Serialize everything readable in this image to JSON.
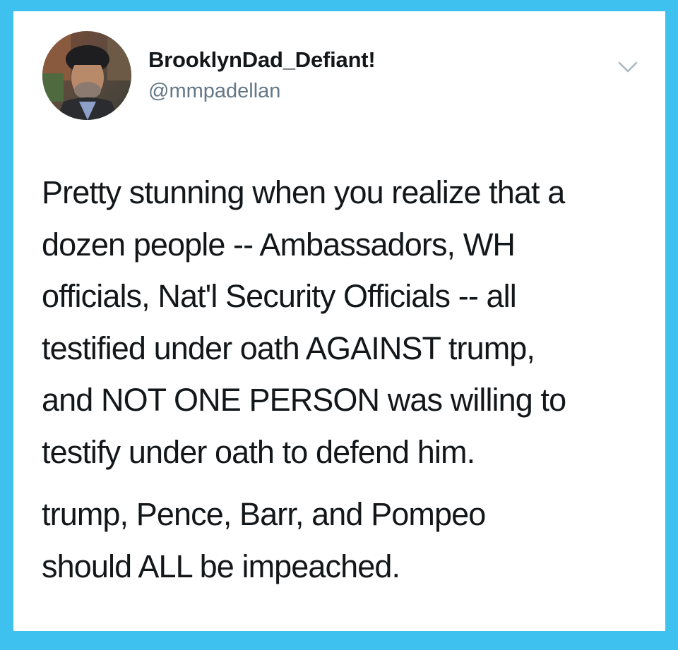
{
  "tweet": {
    "author": {
      "display_name": "BrooklynDad_Defiant!",
      "handle": "@mmpadellan",
      "avatar_icon": "user-avatar-photo"
    },
    "menu_icon": "chevron-down-icon",
    "paragraphs": [
      {
        "lines": [
          "Pretty stunning when you realize that a",
          "dozen people -- Ambassadors, WH",
          "officials, Nat'l Security Officials -- all",
          "testified under oath AGAINST trump,",
          "and NOT ONE PERSON was willing to",
          "testify under oath to defend him."
        ]
      },
      {
        "lines": [
          "trump, Pence, Barr, and Pompeo",
          "should ALL be impeached."
        ]
      }
    ]
  },
  "colors": {
    "frame_border": "#3ec1ee",
    "card_background": "#ffffff",
    "text_primary": "#14171a",
    "text_secondary": "#657786",
    "chevron": "#aab8c2"
  }
}
